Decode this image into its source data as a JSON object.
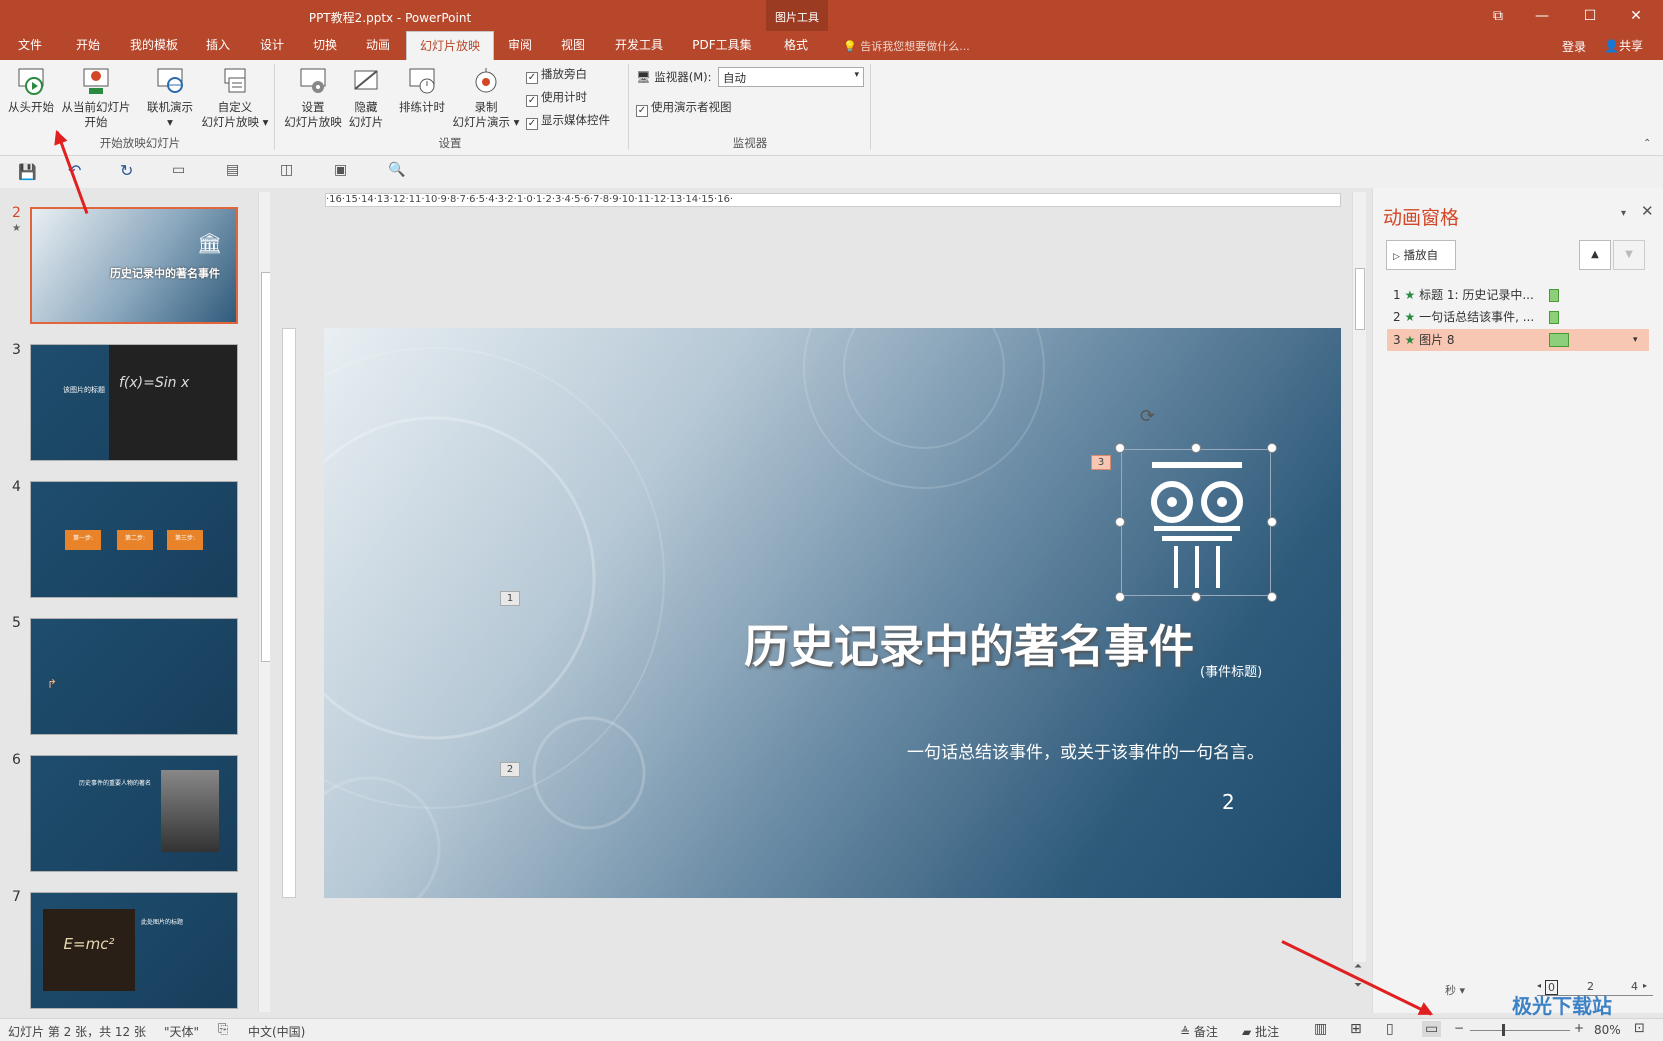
{
  "window": {
    "title": "PPT教程2.pptx - PowerPoint",
    "context_tab_group": "图片工具",
    "win_buttons": [
      "⧉",
      "—",
      "☐",
      "✕"
    ]
  },
  "tabs": [
    "文件",
    "开始",
    "我的模板",
    "插入",
    "设计",
    "切换",
    "动画",
    "幻灯片放映",
    "审阅",
    "视图",
    "开发工具",
    "PDF工具集",
    "格式"
  ],
  "tellme": "告诉我您想要做什么...",
  "account": {
    "login": "登录",
    "share": "共享"
  },
  "ribbon": {
    "from_start": "从头开始",
    "from_current_1": "从当前幻灯片",
    "from_current_2": "开始",
    "online_1": "联机演示",
    "online_2": "▾",
    "custom_1": "自定义",
    "custom_2": "幻灯片放映 ▾",
    "group_start": "开始放映幻灯片",
    "setup_1": "设置",
    "setup_2": "幻灯片放映",
    "hide_1": "隐藏",
    "hide_2": "幻灯片",
    "rehearse": "排练计时",
    "record_1": "录制",
    "record_2": "幻灯片演示 ▾",
    "chk_narration": "播放旁白",
    "chk_timing": "使用计时",
    "chk_media": "显示媒体控件",
    "group_setup": "设置",
    "monitor_label": "监视器(M):",
    "monitor_value": "自动",
    "chk_presenter": "使用演示者视图",
    "group_monitor": "监视器"
  },
  "thumbs": {
    "numbers": [
      "2",
      "3",
      "4",
      "5",
      "6",
      "7"
    ],
    "slide2_title": "历史记录中的著名事件",
    "slide3_title": "该图片的标题",
    "slide4_steps": [
      "第一步:",
      "第二步:",
      "第三步:"
    ],
    "slide6_title": "历史事件的重要人物的著名",
    "slide7_eq": "E=mc²",
    "slide7_title": "此处图片的标题"
  },
  "slide": {
    "title": "历史记录中的著名事件",
    "title_note": "(事件标题)",
    "subtitle": "一句话总结该事件，或关于该事件的一句名言。",
    "page_number": "2",
    "tag1": "1",
    "tag2": "2",
    "tag3": "3",
    "rotate_icon": "⟳"
  },
  "ruler": {
    "h": "·16·15·14·13·12·11·10·9·8·7·6·5·4·3·2·1·0·1·2·3·4·5·6·7·8·9·10·11·12·13·14·15·16·"
  },
  "animpane": {
    "title": "动画窗格",
    "play_from": "播放自",
    "items": [
      {
        "num": "1",
        "label": "标题 1: 历史记录中..."
      },
      {
        "num": "2",
        "label": "一句话总结该事件, ..."
      },
      {
        "num": "3",
        "label": "图片 8"
      }
    ],
    "seconds": "秒 ▾",
    "timeline": [
      "0",
      "2",
      "4"
    ]
  },
  "status": {
    "slide_info": "幻灯片 第 2 张，共 12 张",
    "theme": "\"天体\"",
    "language": "中文(中国)",
    "notes": "备注",
    "comments": "批注",
    "zoom": "80%"
  },
  "watermark": "极光下载站",
  "colors": {
    "accent": "#b7472a",
    "selected_row": "#f8c7b4",
    "slide_thumb_border": "#e2643b"
  }
}
